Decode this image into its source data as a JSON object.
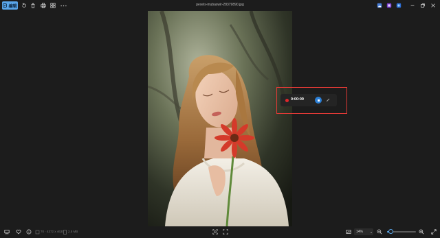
{
  "window": {
    "title": "pexels-mubaswir-28379890.jpg"
  },
  "toolbar": {
    "edit_label": "编辑",
    "icons": [
      "rotate-icon",
      "delete-icon",
      "print-icon",
      "share-icon",
      "more-icon"
    ]
  },
  "recorder": {
    "time": "0:00:09"
  },
  "footer": {
    "resolution": "70 · 4372 x 4630",
    "file_size": "2.5 MB",
    "zoom_value": "14%",
    "zoom_level": 0.14
  },
  "colors": {
    "accent": "#5aa6ea",
    "record": "#e0262a",
    "highlight_border": "#e23a36"
  }
}
